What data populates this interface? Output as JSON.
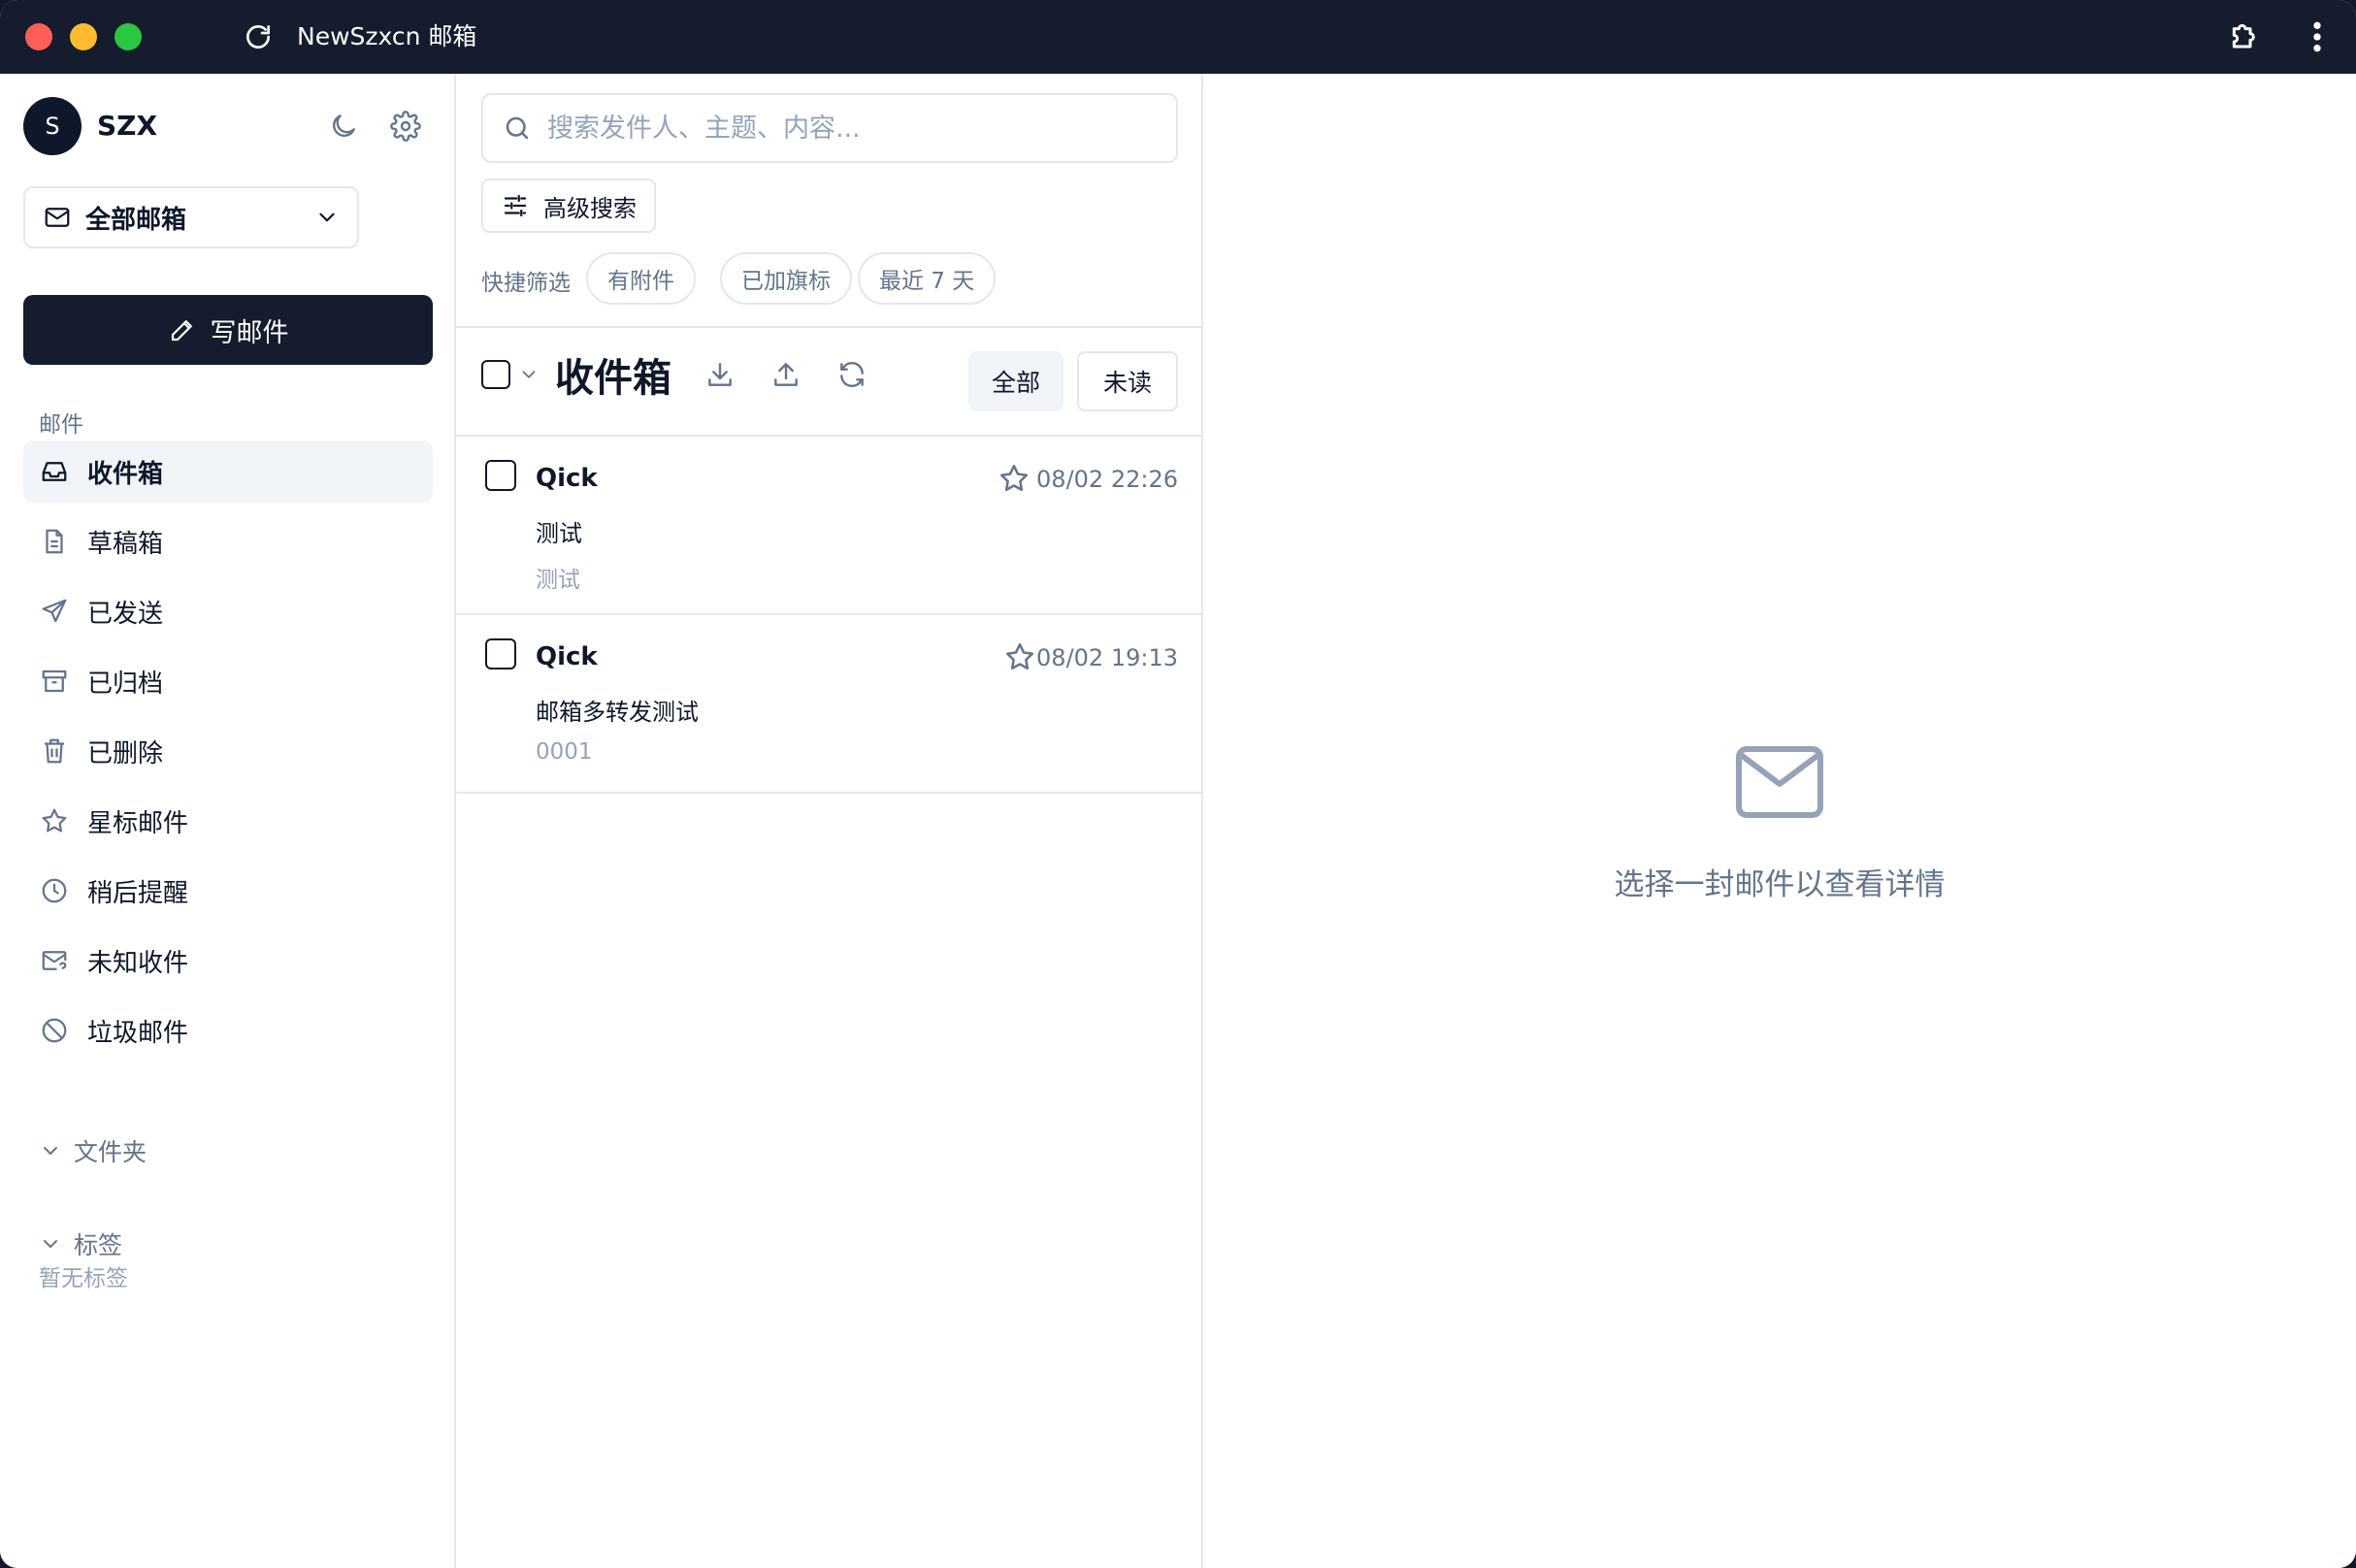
{
  "window": {
    "title": "NewSzxcn 邮箱"
  },
  "sidebar": {
    "avatar_initial": "S",
    "username": "SZX",
    "mailbox_select": "全部邮箱",
    "compose_label": "写邮件",
    "section_label": "邮件",
    "items": [
      {
        "label": "收件箱",
        "icon": "inbox-icon",
        "active": true
      },
      {
        "label": "草稿箱",
        "icon": "draft-icon"
      },
      {
        "label": "已发送",
        "icon": "send-icon"
      },
      {
        "label": "已归档",
        "icon": "archive-icon"
      },
      {
        "label": "已删除",
        "icon": "trash-icon"
      },
      {
        "label": "星标邮件",
        "icon": "star-icon"
      },
      {
        "label": "稍后提醒",
        "icon": "clock-icon"
      },
      {
        "label": "未知收件",
        "icon": "unknown-mail-icon"
      },
      {
        "label": "垃圾邮件",
        "icon": "spam-icon"
      }
    ],
    "folders_label": "文件夹",
    "tags_label": "标签",
    "no_tags": "暂无标签"
  },
  "list": {
    "search_placeholder": "搜索发件人、主题、内容...",
    "advanced_search": "高级搜索",
    "quick_filter_label": "快捷筛选",
    "chips": [
      "有附件",
      "已加旗标",
      "最近 7 天"
    ],
    "title": "收件箱",
    "filter_all": "全部",
    "filter_unread": "未读",
    "emails": [
      {
        "sender": "Qick",
        "subject": "测试",
        "preview": "测试",
        "date": "08/02 22:26"
      },
      {
        "sender": "Qick",
        "subject": "邮箱多转发测试",
        "preview": "0001",
        "date": "08/02 19:13"
      }
    ]
  },
  "detail": {
    "empty_text": "选择一封邮件以查看详情"
  },
  "colors": {
    "titlebar": "#141c2e",
    "primary": "#141c2e",
    "muted": "#64748b",
    "border": "#e5e7eb"
  }
}
